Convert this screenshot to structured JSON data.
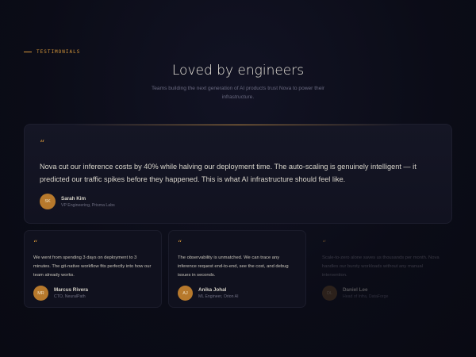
{
  "section": {
    "eyebrow": "TESTIMONIALS",
    "title": "Loved by engineers",
    "subtitle": "Teams building the next generation of AI products trust Nova to power their infrastructure."
  },
  "colors": {
    "accent": "#d4953a",
    "background": "#0b0c17",
    "card": "#10111e"
  },
  "featured": {
    "quote_icon": "quote-icon",
    "quote": "Nova cut our inference costs by 40% while halving our deployment time. The auto-scaling is genuinely intelligent — it predicted our traffic spikes before they happened. This is what AI infrastructure should feel like.",
    "author": {
      "initials": "SK",
      "name": "Sarah Kim",
      "role": "VP Engineering, Prisma Labs"
    }
  },
  "testimonials": [
    {
      "quote": "We went from spending 3 days on deployment to 3 minutes. The git-native workflow fits perfectly into how our team already works.",
      "author": {
        "initials": "MR",
        "name": "Marcus Rivera",
        "role": "CTO, NeuralPath"
      }
    },
    {
      "quote": "The observability is unmatched. We can trace any inference request end-to-end, see the cost, and debug issues in seconds.",
      "author": {
        "initials": "AJ",
        "name": "Anika Johal",
        "role": "ML Engineer, Orion AI"
      }
    },
    {
      "quote": "Scale-to-zero alone saves us thousands per month. Nova handles our bursty workloads without any manual intervention.",
      "author": {
        "initials": "DL",
        "name": "Daniel Lee",
        "role": "Head of Infra, DataForge"
      }
    }
  ]
}
